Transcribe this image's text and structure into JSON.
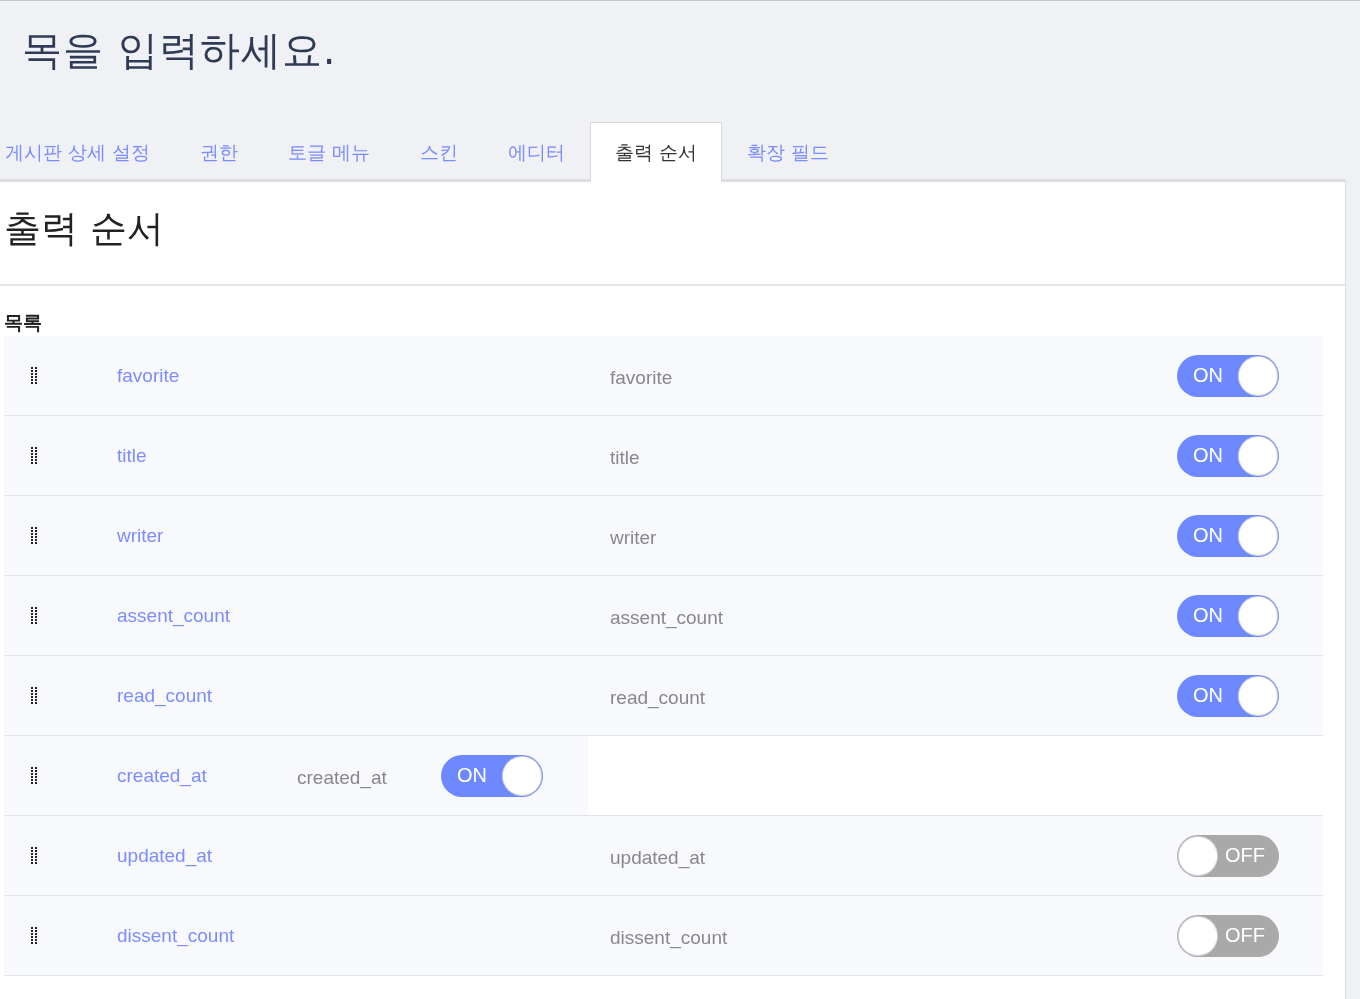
{
  "page_title": "목을 입력하세요.",
  "tabs": [
    {
      "label": "게시판 상세 설정",
      "selected": false
    },
    {
      "label": "권한",
      "selected": false
    },
    {
      "label": "토글 메뉴",
      "selected": false
    },
    {
      "label": "스킨",
      "selected": false
    },
    {
      "label": "에디터",
      "selected": false
    },
    {
      "label": "출력 순서",
      "selected": true
    },
    {
      "label": "확장 필드",
      "selected": false
    }
  ],
  "panel": {
    "title": "출력 순서",
    "section_label": "목록",
    "rows": [
      {
        "kind": "normal",
        "field": "favorite",
        "name": "favorite",
        "toggle": {
          "on": true,
          "label": "ON"
        }
      },
      {
        "kind": "normal",
        "field": "title",
        "name": "title",
        "toggle": {
          "on": true,
          "label": "ON"
        }
      },
      {
        "kind": "normal",
        "field": "writer",
        "name": "writer",
        "toggle": {
          "on": true,
          "label": "ON"
        }
      },
      {
        "kind": "normal",
        "field": "assent_count",
        "name": "assent_count",
        "toggle": {
          "on": true,
          "label": "ON"
        }
      },
      {
        "kind": "normal",
        "field": "read_count",
        "name": "read_count",
        "toggle": {
          "on": true,
          "label": "ON"
        }
      },
      {
        "kind": "dragging",
        "field": "created_at",
        "name": "created_at",
        "toggle": {
          "on": true,
          "label": "ON"
        }
      },
      {
        "kind": "normal",
        "field": "updated_at",
        "name": "updated_at",
        "toggle": {
          "on": false,
          "label": "OFF"
        }
      },
      {
        "kind": "normal",
        "field": "dissent_count",
        "name": "dissent_count",
        "toggle": {
          "on": false,
          "label": "OFF"
        }
      }
    ]
  }
}
